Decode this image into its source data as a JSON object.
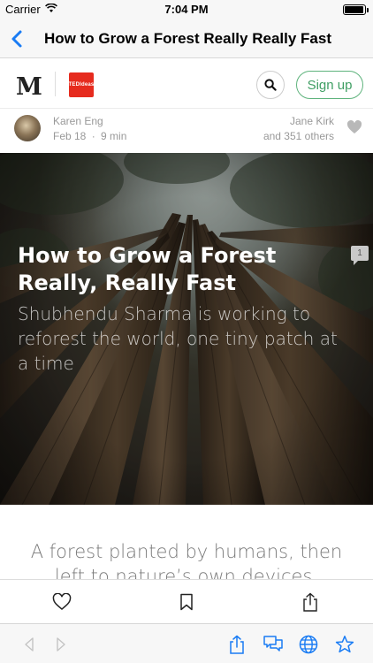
{
  "status_bar": {
    "carrier": "Carrier",
    "time": "7:04 PM",
    "icons": [
      "wifi-icon",
      "battery-icon"
    ]
  },
  "nav_bar": {
    "title": "How to Grow a Forest Really Really Fast",
    "back_icon": "chevron-left-icon"
  },
  "medium_header": {
    "logo": "M",
    "publication_logo_text": "TEDIdeas",
    "search_icon": "search-icon",
    "signup_label": "Sign up"
  },
  "author": {
    "name": "Karen Eng",
    "date": "Feb 18",
    "separator": "·",
    "read_time": "9 min",
    "recommended_by": "Jane Kirk",
    "recommended_others": "and 351 others"
  },
  "hero": {
    "title": "How to Grow a Forest Really, Really Fast",
    "subtitle": "Shubhendu Sharma is working to reforest the world, one tiny patch at a time",
    "comment_count": "1"
  },
  "body": {
    "lead": "A forest planted by humans, then left to nature’s own devices, typically"
  },
  "article_toolbar": {
    "items": [
      "heart-icon",
      "bookmark-icon",
      "share-icon"
    ]
  },
  "browser_toolbar": {
    "items": [
      "back-arrow-icon",
      "forward-arrow-icon",
      "share-icon",
      "chat-icon",
      "globe-icon",
      "star-icon"
    ]
  },
  "colors": {
    "accent_blue": "#1a7cf4",
    "signup_green": "#3f9e63",
    "publication_red": "#e62b1e"
  }
}
